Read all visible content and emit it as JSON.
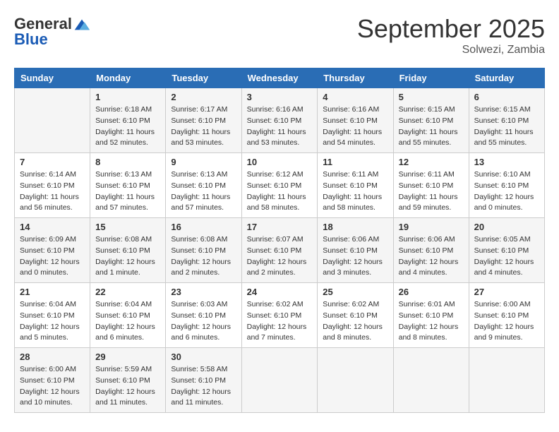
{
  "logo": {
    "line1": "General",
    "line2": "Blue"
  },
  "title": "September 2025",
  "location": "Solwezi, Zambia",
  "days_header": [
    "Sunday",
    "Monday",
    "Tuesday",
    "Wednesday",
    "Thursday",
    "Friday",
    "Saturday"
  ],
  "weeks": [
    [
      {
        "day": "",
        "sunrise": "",
        "sunset": "",
        "daylight": ""
      },
      {
        "day": "1",
        "sunrise": "Sunrise: 6:18 AM",
        "sunset": "Sunset: 6:10 PM",
        "daylight": "Daylight: 11 hours and 52 minutes."
      },
      {
        "day": "2",
        "sunrise": "Sunrise: 6:17 AM",
        "sunset": "Sunset: 6:10 PM",
        "daylight": "Daylight: 11 hours and 53 minutes."
      },
      {
        "day": "3",
        "sunrise": "Sunrise: 6:16 AM",
        "sunset": "Sunset: 6:10 PM",
        "daylight": "Daylight: 11 hours and 53 minutes."
      },
      {
        "day": "4",
        "sunrise": "Sunrise: 6:16 AM",
        "sunset": "Sunset: 6:10 PM",
        "daylight": "Daylight: 11 hours and 54 minutes."
      },
      {
        "day": "5",
        "sunrise": "Sunrise: 6:15 AM",
        "sunset": "Sunset: 6:10 PM",
        "daylight": "Daylight: 11 hours and 55 minutes."
      },
      {
        "day": "6",
        "sunrise": "Sunrise: 6:15 AM",
        "sunset": "Sunset: 6:10 PM",
        "daylight": "Daylight: 11 hours and 55 minutes."
      }
    ],
    [
      {
        "day": "7",
        "sunrise": "Sunrise: 6:14 AM",
        "sunset": "Sunset: 6:10 PM",
        "daylight": "Daylight: 11 hours and 56 minutes."
      },
      {
        "day": "8",
        "sunrise": "Sunrise: 6:13 AM",
        "sunset": "Sunset: 6:10 PM",
        "daylight": "Daylight: 11 hours and 57 minutes."
      },
      {
        "day": "9",
        "sunrise": "Sunrise: 6:13 AM",
        "sunset": "Sunset: 6:10 PM",
        "daylight": "Daylight: 11 hours and 57 minutes."
      },
      {
        "day": "10",
        "sunrise": "Sunrise: 6:12 AM",
        "sunset": "Sunset: 6:10 PM",
        "daylight": "Daylight: 11 hours and 58 minutes."
      },
      {
        "day": "11",
        "sunrise": "Sunrise: 6:11 AM",
        "sunset": "Sunset: 6:10 PM",
        "daylight": "Daylight: 11 hours and 58 minutes."
      },
      {
        "day": "12",
        "sunrise": "Sunrise: 6:11 AM",
        "sunset": "Sunset: 6:10 PM",
        "daylight": "Daylight: 11 hours and 59 minutes."
      },
      {
        "day": "13",
        "sunrise": "Sunrise: 6:10 AM",
        "sunset": "Sunset: 6:10 PM",
        "daylight": "Daylight: 12 hours and 0 minutes."
      }
    ],
    [
      {
        "day": "14",
        "sunrise": "Sunrise: 6:09 AM",
        "sunset": "Sunset: 6:10 PM",
        "daylight": "Daylight: 12 hours and 0 minutes."
      },
      {
        "day": "15",
        "sunrise": "Sunrise: 6:08 AM",
        "sunset": "Sunset: 6:10 PM",
        "daylight": "Daylight: 12 hours and 1 minute."
      },
      {
        "day": "16",
        "sunrise": "Sunrise: 6:08 AM",
        "sunset": "Sunset: 6:10 PM",
        "daylight": "Daylight: 12 hours and 2 minutes."
      },
      {
        "day": "17",
        "sunrise": "Sunrise: 6:07 AM",
        "sunset": "Sunset: 6:10 PM",
        "daylight": "Daylight: 12 hours and 2 minutes."
      },
      {
        "day": "18",
        "sunrise": "Sunrise: 6:06 AM",
        "sunset": "Sunset: 6:10 PM",
        "daylight": "Daylight: 12 hours and 3 minutes."
      },
      {
        "day": "19",
        "sunrise": "Sunrise: 6:06 AM",
        "sunset": "Sunset: 6:10 PM",
        "daylight": "Daylight: 12 hours and 4 minutes."
      },
      {
        "day": "20",
        "sunrise": "Sunrise: 6:05 AM",
        "sunset": "Sunset: 6:10 PM",
        "daylight": "Daylight: 12 hours and 4 minutes."
      }
    ],
    [
      {
        "day": "21",
        "sunrise": "Sunrise: 6:04 AM",
        "sunset": "Sunset: 6:10 PM",
        "daylight": "Daylight: 12 hours and 5 minutes."
      },
      {
        "day": "22",
        "sunrise": "Sunrise: 6:04 AM",
        "sunset": "Sunset: 6:10 PM",
        "daylight": "Daylight: 12 hours and 6 minutes."
      },
      {
        "day": "23",
        "sunrise": "Sunrise: 6:03 AM",
        "sunset": "Sunset: 6:10 PM",
        "daylight": "Daylight: 12 hours and 6 minutes."
      },
      {
        "day": "24",
        "sunrise": "Sunrise: 6:02 AM",
        "sunset": "Sunset: 6:10 PM",
        "daylight": "Daylight: 12 hours and 7 minutes."
      },
      {
        "day": "25",
        "sunrise": "Sunrise: 6:02 AM",
        "sunset": "Sunset: 6:10 PM",
        "daylight": "Daylight: 12 hours and 8 minutes."
      },
      {
        "day": "26",
        "sunrise": "Sunrise: 6:01 AM",
        "sunset": "Sunset: 6:10 PM",
        "daylight": "Daylight: 12 hours and 8 minutes."
      },
      {
        "day": "27",
        "sunrise": "Sunrise: 6:00 AM",
        "sunset": "Sunset: 6:10 PM",
        "daylight": "Daylight: 12 hours and 9 minutes."
      }
    ],
    [
      {
        "day": "28",
        "sunrise": "Sunrise: 6:00 AM",
        "sunset": "Sunset: 6:10 PM",
        "daylight": "Daylight: 12 hours and 10 minutes."
      },
      {
        "day": "29",
        "sunrise": "Sunrise: 5:59 AM",
        "sunset": "Sunset: 6:10 PM",
        "daylight": "Daylight: 12 hours and 11 minutes."
      },
      {
        "day": "30",
        "sunrise": "Sunrise: 5:58 AM",
        "sunset": "Sunset: 6:10 PM",
        "daylight": "Daylight: 12 hours and 11 minutes."
      },
      {
        "day": "",
        "sunrise": "",
        "sunset": "",
        "daylight": ""
      },
      {
        "day": "",
        "sunrise": "",
        "sunset": "",
        "daylight": ""
      },
      {
        "day": "",
        "sunrise": "",
        "sunset": "",
        "daylight": ""
      },
      {
        "day": "",
        "sunrise": "",
        "sunset": "",
        "daylight": ""
      }
    ]
  ]
}
